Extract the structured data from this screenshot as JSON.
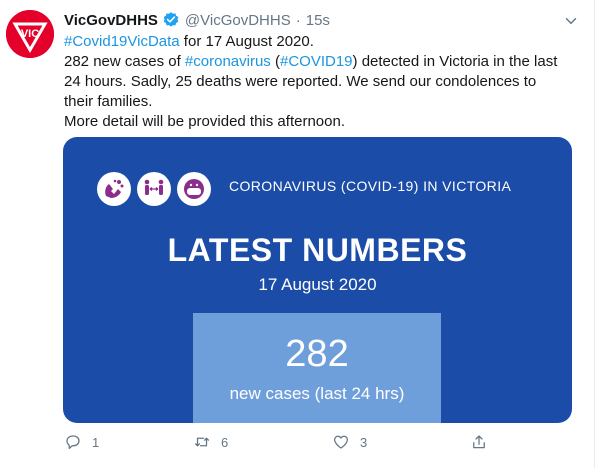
{
  "tweet": {
    "display_name": "VicGovDHHS",
    "handle": "@VicGovDHHS",
    "separator": "·",
    "time": "15s",
    "text": {
      "line1_hashtag": "#Covid19VicData",
      "line1_rest": " for 17 August 2020.",
      "line2_a": "282 new cases of ",
      "line2_hashtag1": "#coronavirus",
      "line2_b": " (",
      "line2_hashtag2": "#COVID19",
      "line2_c": ") detected in Victoria in the last",
      "line3": "24 hours. Sadly, 25 deaths were reported. We send our condolences to",
      "line4": "their families.",
      "line5": "More detail will be provided this afternoon."
    },
    "colors": {
      "link": "#1b95e0",
      "avatar": "#e4002b",
      "card_bg": "#1b4da8",
      "card_box": "#6f9fdb",
      "icon_purple": "#8a2d8c"
    }
  },
  "card": {
    "icons": [
      "handwashing-icon",
      "distancing-icon",
      "mask-icon"
    ],
    "heading": "CORONAVIRUS (COVID-19) IN VICTORIA",
    "title": "LATEST NUMBERS",
    "date": "17 August 2020",
    "number": "282",
    "number_label": "new cases (last 24 hrs)"
  },
  "actions": {
    "reply_count": "1",
    "retweet_count": "6",
    "like_count": "3",
    "icons": [
      "reply-icon",
      "retweet-icon",
      "like-icon",
      "share-icon"
    ]
  }
}
